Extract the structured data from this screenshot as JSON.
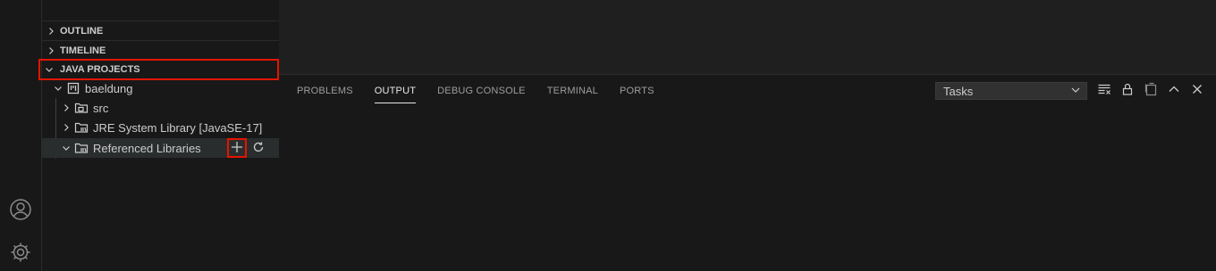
{
  "sidebar": {
    "sections": {
      "outline": "OUTLINE",
      "timeline": "TIMELINE",
      "java_projects": "JAVA PROJECTS"
    },
    "tree": {
      "project": "baeldung",
      "src": "src",
      "jre": "JRE System Library [JavaSE-17]",
      "referenced": "Referenced Libraries"
    }
  },
  "panel": {
    "tabs": [
      "PROBLEMS",
      "OUTPUT",
      "DEBUG CONSOLE",
      "TERMINAL",
      "PORTS"
    ],
    "active_tab": "OUTPUT",
    "output_channel": "Tasks"
  },
  "icons": {
    "activity": [
      "account-icon",
      "manage-gear-icon"
    ],
    "row_actions": [
      "add-icon",
      "refresh-icon"
    ],
    "panel_tools": [
      "clear-output-icon",
      "lock-scroll-icon",
      "open-in-editor-icon",
      "maximize-panel-icon",
      "close-panel-icon"
    ]
  },
  "colors": {
    "highlight": "#e51400",
    "background": "#1f1f1f",
    "sidebar": "#181818"
  }
}
